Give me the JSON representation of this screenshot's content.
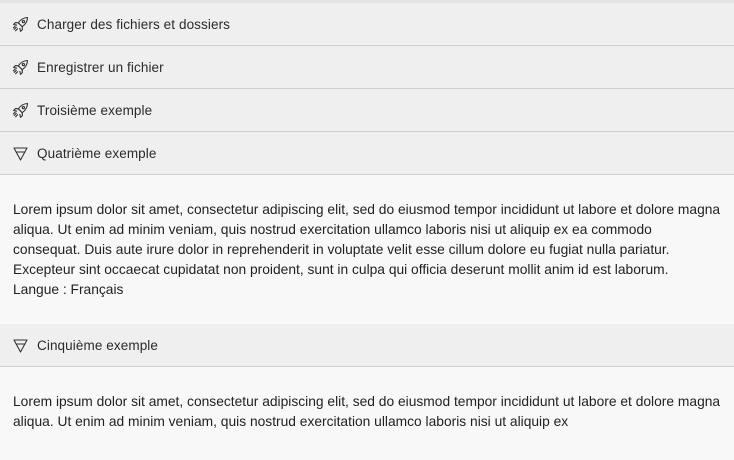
{
  "accordion": {
    "items": [
      {
        "label": "Charger des fichiers et dossiers",
        "icon": "rocket-icon",
        "expanded": false
      },
      {
        "label": "Enregistrer un fichier",
        "icon": "rocket-icon",
        "expanded": false
      },
      {
        "label": "Troisième exemple",
        "icon": "rocket-icon",
        "expanded": false
      },
      {
        "label": "Quatrième exemple",
        "icon": "funnel-icon",
        "expanded": true,
        "content": "Lorem ipsum dolor sit amet, consectetur adipiscing elit, sed do eiusmod tempor incididunt ut labore et dolore magna aliqua. Ut enim ad minim veniam, quis nostrud exercitation ullamco laboris nisi ut aliquip ex ea commodo consequat. Duis aute irure dolor in reprehenderit in voluptate velit esse cillum dolore eu fugiat nulla pariatur. Excepteur sint occaecat cupidatat non proident, sunt in culpa qui officia deserunt mollit anim id est laborum.",
        "language_line": "Langue : Français"
      },
      {
        "label": "Cinquième exemple",
        "icon": "funnel-icon",
        "expanded": true,
        "content": "Lorem ipsum dolor sit amet, consectetur adipiscing elit, sed do eiusmod tempor incididunt ut labore et dolore magna aliqua. Ut enim ad minim veniam, quis nostrud exercitation ullamco laboris nisi ut aliquip ex"
      }
    ]
  },
  "colors": {
    "header_bg": "#efefef",
    "panel_bg": "#f8f8f8",
    "divider": "#cfcfcf",
    "text": "#222222"
  }
}
